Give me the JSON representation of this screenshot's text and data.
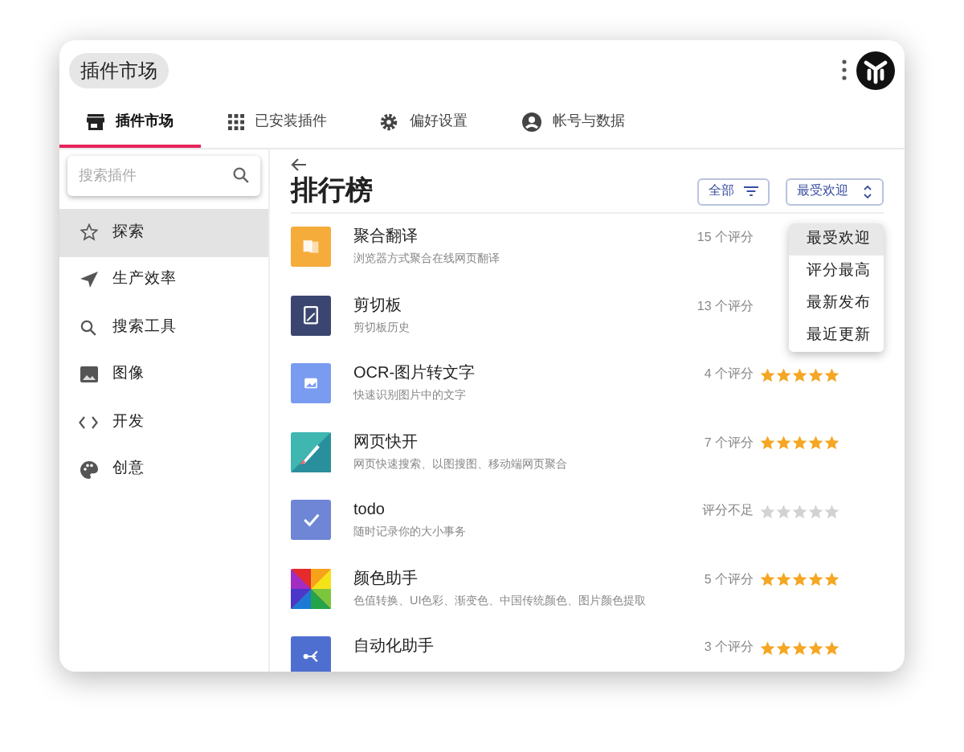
{
  "window": {
    "title": "插件市场"
  },
  "tabs": [
    {
      "label": "插件市场",
      "selected": true
    },
    {
      "label": "已安装插件",
      "selected": false
    },
    {
      "label": "偏好设置",
      "selected": false
    },
    {
      "label": "帐号与数据",
      "selected": false
    }
  ],
  "sidebar": {
    "search": {
      "placeholder": "搜索插件"
    },
    "items": [
      {
        "label": "探索",
        "selected": true
      },
      {
        "label": "生产效率",
        "selected": false
      },
      {
        "label": "搜索工具",
        "selected": false
      },
      {
        "label": "图像",
        "selected": false
      },
      {
        "label": "开发",
        "selected": false
      },
      {
        "label": "创意",
        "selected": false
      }
    ]
  },
  "main": {
    "title": "排行榜",
    "filter_button": "全部",
    "sort_button": "最受欢迎",
    "sort_menu": [
      {
        "label": "最受欢迎",
        "selected": true
      },
      {
        "label": "评分最高",
        "selected": false
      },
      {
        "label": "最新发布",
        "selected": false
      },
      {
        "label": "最近更新",
        "selected": false
      }
    ],
    "plugins": [
      {
        "name": "聚合翻译",
        "description": "浏览器方式聚合在线网页翻译",
        "rating_count": "15 个评分"
      },
      {
        "name": "剪切板",
        "description": "剪切板历史",
        "rating_count": "13 个评分"
      },
      {
        "name": "OCR-图片转文字",
        "description": "快速识别图片中的文字",
        "rating_count": "4 个评分",
        "stars": 5
      },
      {
        "name": "网页快开",
        "description": "网页快速搜索、以图搜图、移动端网页聚合",
        "rating_count": "7 个评分",
        "stars": 5
      },
      {
        "name": "todo",
        "description": "随时记录你的大小事务",
        "rating_count": "评分不足",
        "stars": 0
      },
      {
        "name": "颜色助手",
        "description": "色值转换、UI色彩、渐变色、中国传统颜色、图片颜色提取",
        "rating_count": "5 个评分",
        "stars": 5
      },
      {
        "name": "自动化助手",
        "rating_count": "3 个评分",
        "stars": 5
      }
    ]
  }
}
